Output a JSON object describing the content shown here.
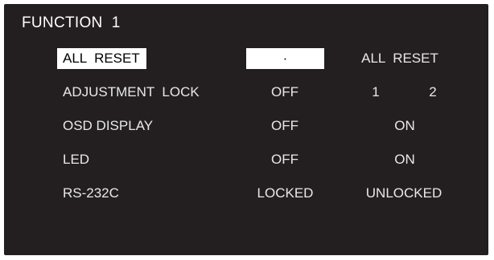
{
  "menu": {
    "title": "FUNCTION  1",
    "rows": [
      {
        "label": "ALL  RESET",
        "options": [
          "·",
          "ALL  RESET"
        ]
      },
      {
        "label": "ADJUSTMENT  LOCK",
        "options": [
          "OFF",
          "1",
          "2"
        ]
      },
      {
        "label": "OSD DISPLAY",
        "options": [
          "OFF",
          "ON"
        ]
      },
      {
        "label": "LED",
        "options": [
          "OFF",
          "ON"
        ]
      },
      {
        "label": "RS-232C",
        "options": [
          "LOCKED",
          "UNLOCKED"
        ]
      }
    ]
  },
  "colors": {
    "background": "#231f20",
    "text": "#e8e8e8",
    "highlight": "#ffffff"
  }
}
